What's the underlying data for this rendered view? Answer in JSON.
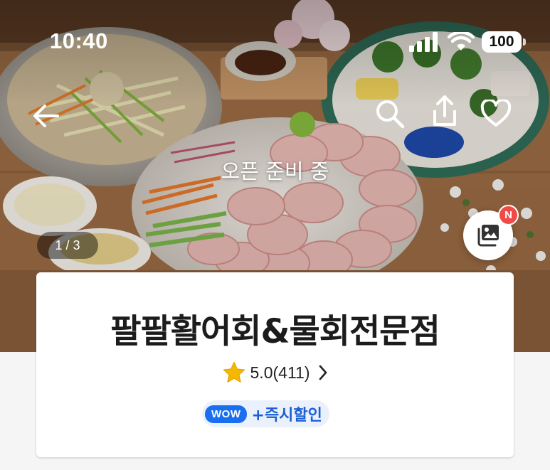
{
  "status_bar": {
    "time": "10:40",
    "battery": "100"
  },
  "hero": {
    "open_status": "오픈 준비 중",
    "page_counter": "1 / 3",
    "new_badge": "N"
  },
  "store": {
    "name": "팔팔활어회&물회전문점",
    "rating": "5.0(411)",
    "promo_badge": "WOW",
    "promo_text": "+즉시할인"
  },
  "icons": [
    "back-arrow-icon",
    "search-icon",
    "share-icon",
    "heart-icon",
    "gallery-icon",
    "star-icon",
    "chevron-right-icon"
  ],
  "colors": {
    "accent_blue": "#1a6ef0",
    "badge_red": "#ee4b47",
    "star": "#f5b800"
  }
}
